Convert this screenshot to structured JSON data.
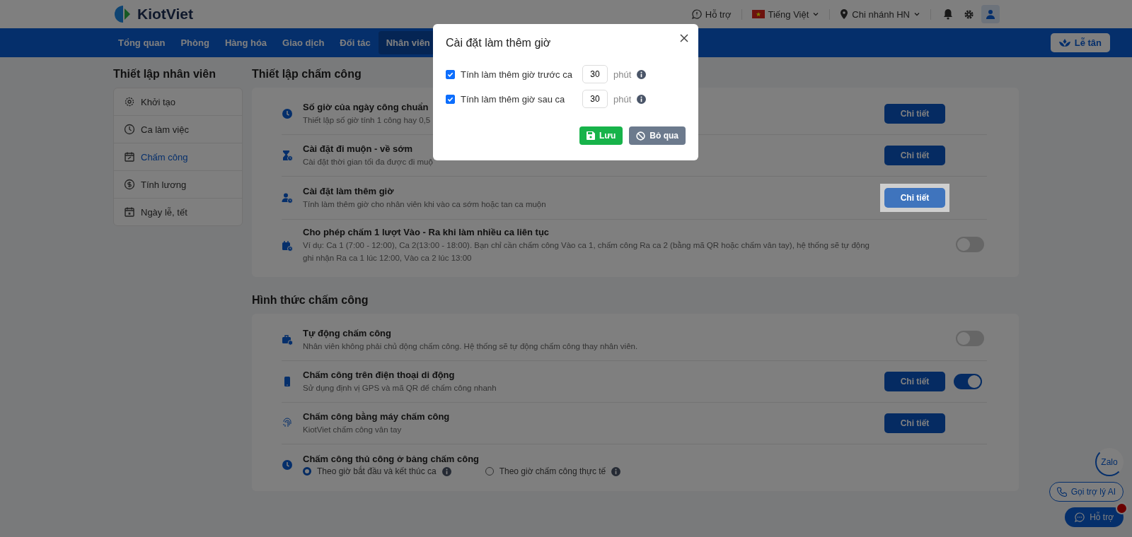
{
  "header": {
    "logo_text": "KiotViet",
    "support": "Hỗ trợ",
    "language": "Tiếng Việt",
    "branch": "Chi nhánh HN"
  },
  "nav": {
    "tabs": [
      {
        "label": "Tổng quan",
        "selected": false
      },
      {
        "label": "Phòng",
        "selected": false
      },
      {
        "label": "Hàng hóa",
        "selected": false
      },
      {
        "label": "Giao dịch",
        "selected": false
      },
      {
        "label": "Đối tác",
        "selected": false
      },
      {
        "label": "Nhân viên",
        "selected": true
      }
    ],
    "reception_button": "Lễ tân"
  },
  "sidebar": {
    "title": "Thiết lập nhân viên",
    "items": [
      {
        "kind": "gear",
        "label": "Khởi tạo",
        "selected": false
      },
      {
        "kind": "clock",
        "label": "Ca làm việc",
        "selected": false
      },
      {
        "kind": "calendar",
        "label": "Chấm công",
        "selected": true
      },
      {
        "kind": "money",
        "label": "Tính lương",
        "selected": false
      },
      {
        "kind": "holiday",
        "label": "Ngày lễ, tết",
        "selected": false
      }
    ]
  },
  "sections": [
    {
      "title": "Thiết lập chấm công",
      "rows": [
        {
          "title": "Số giờ của ngày công chuẩn",
          "description": "Thiết lập số giờ tính 1 công hay 0,5",
          "kind": "button",
          "button_label": "Chi tiết",
          "highlighted": false
        },
        {
          "title": "Cài đặt đi muộn - về sớm",
          "description": "Cài đặt thời gian tối đa được đi muộ",
          "kind": "button",
          "button_label": "Chi tiết",
          "highlighted": false
        },
        {
          "title": "Cài đặt làm thêm giờ",
          "description": "Tính làm thêm giờ cho nhân viên khi vào ca sớm hoặc tan ca muộn",
          "kind": "button",
          "button_label": "Chi tiết",
          "highlighted": true
        },
        {
          "title": "Cho phép chấm 1 lượt Vào - Ra khi làm nhiều ca liên tục",
          "description": "Ví dụ: Ca 1 (7:00 - 12:00), Ca 2(13:00 - 18:00). Bạn chỉ cần chấm công Vào ca 1, chấm công Ra ca 2 (bằng mã QR hoặc chấm vân tay), hệ thống sẽ tự động ghi nhận Ra ca 1 lúc 12:00, Vào ca 2 lúc 13:00",
          "kind": "toggle",
          "on": false
        }
      ]
    },
    {
      "title": "Hình thức chấm công",
      "rows": [
        {
          "title": "Tự động chấm công",
          "description": "Nhân viên không phải chủ động chấm công. Hệ thống sẽ tự động chấm công thay nhân viên.",
          "kind": "toggle",
          "on": false
        },
        {
          "title": "Chấm công trên điện thoại di động",
          "description": "Sử dụng định vị GPS và mã QR để chấm công nhanh",
          "kind": "button_toggle",
          "button_label": "Chi tiết",
          "highlighted": false,
          "on": true
        },
        {
          "title": "Chấm công bằng máy chấm công",
          "description": "KiotViet chấm công vân tay",
          "kind": "button",
          "button_label": "Chi tiết",
          "highlighted": false
        },
        {
          "title": "Chấm công thủ công ở bảng chấm công",
          "kind": "radios",
          "options": [
            {
              "label": "Theo giờ bắt đầu và kết thúc ca",
              "selected": true
            },
            {
              "label": "Theo giờ chấm công thực tế",
              "selected": false
            }
          ]
        }
      ]
    }
  ],
  "modal": {
    "title": "Cài đặt làm thêm giờ",
    "options": [
      {
        "checked": true,
        "label": "Tính làm thêm giờ trước ca",
        "value": "30",
        "unit": "phút"
      },
      {
        "checked": true,
        "label": "Tính làm thêm giờ sau ca",
        "value": "30",
        "unit": "phút"
      }
    ],
    "save": "Lưu",
    "cancel": "Bỏ qua"
  },
  "floating": {
    "zalo": "Zalo",
    "ai_call": "Gọi trợ lý AI",
    "support_chat": "Hỗ trợ"
  }
}
